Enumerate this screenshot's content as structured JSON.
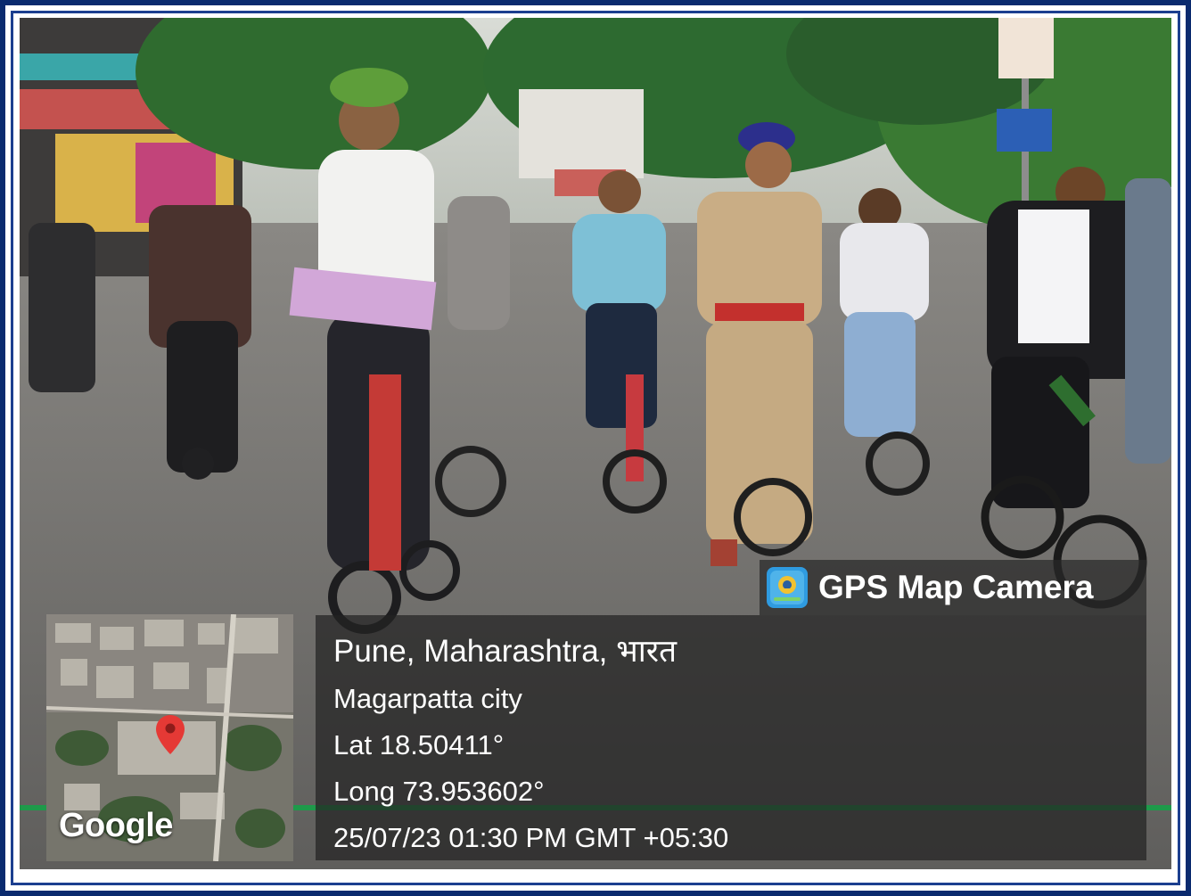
{
  "overlay": {
    "app_badge": "GPS Map Camera",
    "location": "Pune, Maharashtra, भारत",
    "area": "Magarpatta city",
    "latitude": "Lat 18.50411°",
    "longitude": "Long 73.953602°",
    "datetime": "25/07/23 01:30 PM GMT +05:30"
  },
  "map": {
    "logo": "Google",
    "pin_icon": "map-pin-icon"
  },
  "colors": {
    "frame": "#0a2a6e",
    "green_strip": "#1e9a4a",
    "badge_icon": "#2f9be0",
    "pin": "#e53935"
  }
}
